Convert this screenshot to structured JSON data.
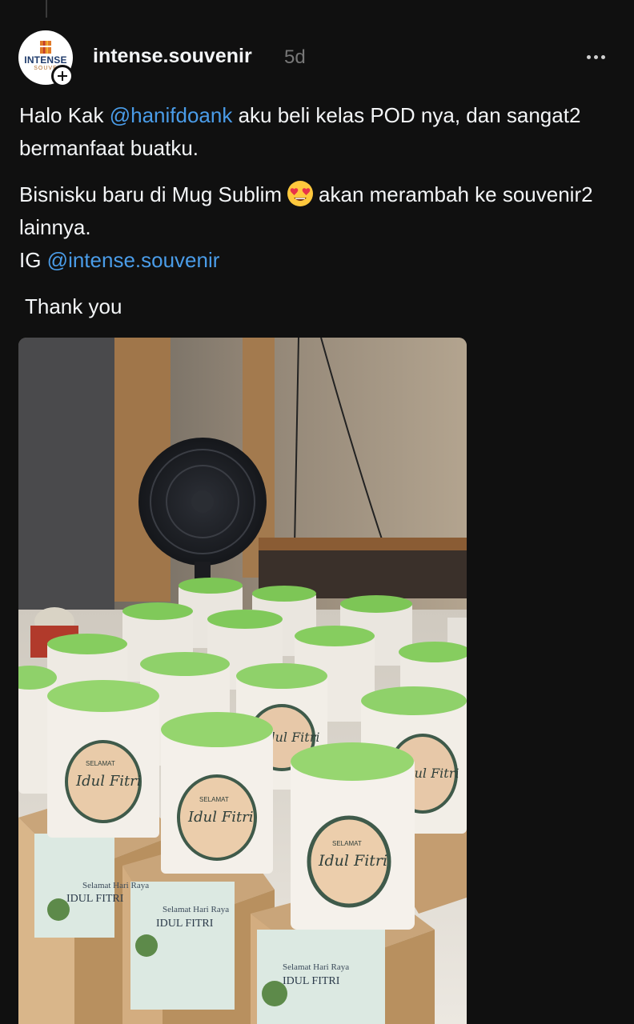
{
  "author": {
    "username": "intense.souvenir",
    "time_ago": "5d",
    "avatar_brand": "INTENSE",
    "avatar_sub": "SOUVE"
  },
  "post": {
    "greeting": "Halo Kak ",
    "mention1": "@hanifdoank",
    "line1_rest": " aku beli kelas POD nya, dan sangat2 bermanfaat buatku.",
    "line2_a": "Bisnisku baru di Mug Sublim",
    "line2_b": "akan merambah ke souvenir2 lainnya.",
    "ig_prefix": "IG ",
    "mention2": "@intense.souvenir",
    "thanks": "Thank you"
  },
  "icons": {
    "emoji": "heart-eyes-emoji",
    "more": "more-options-icon",
    "follow": "plus-icon"
  },
  "image": {
    "mug_text_small": "SELAMAT",
    "mug_text_main": "Idul Fitri",
    "box_text_small": "Selamat Hari Raya",
    "box_text_main": "IDUL FITRI"
  },
  "colors": {
    "mention": "#4a9ce8",
    "background": "#101010",
    "text": "#f3f5f7",
    "mug_inner": "#8fd16a"
  }
}
